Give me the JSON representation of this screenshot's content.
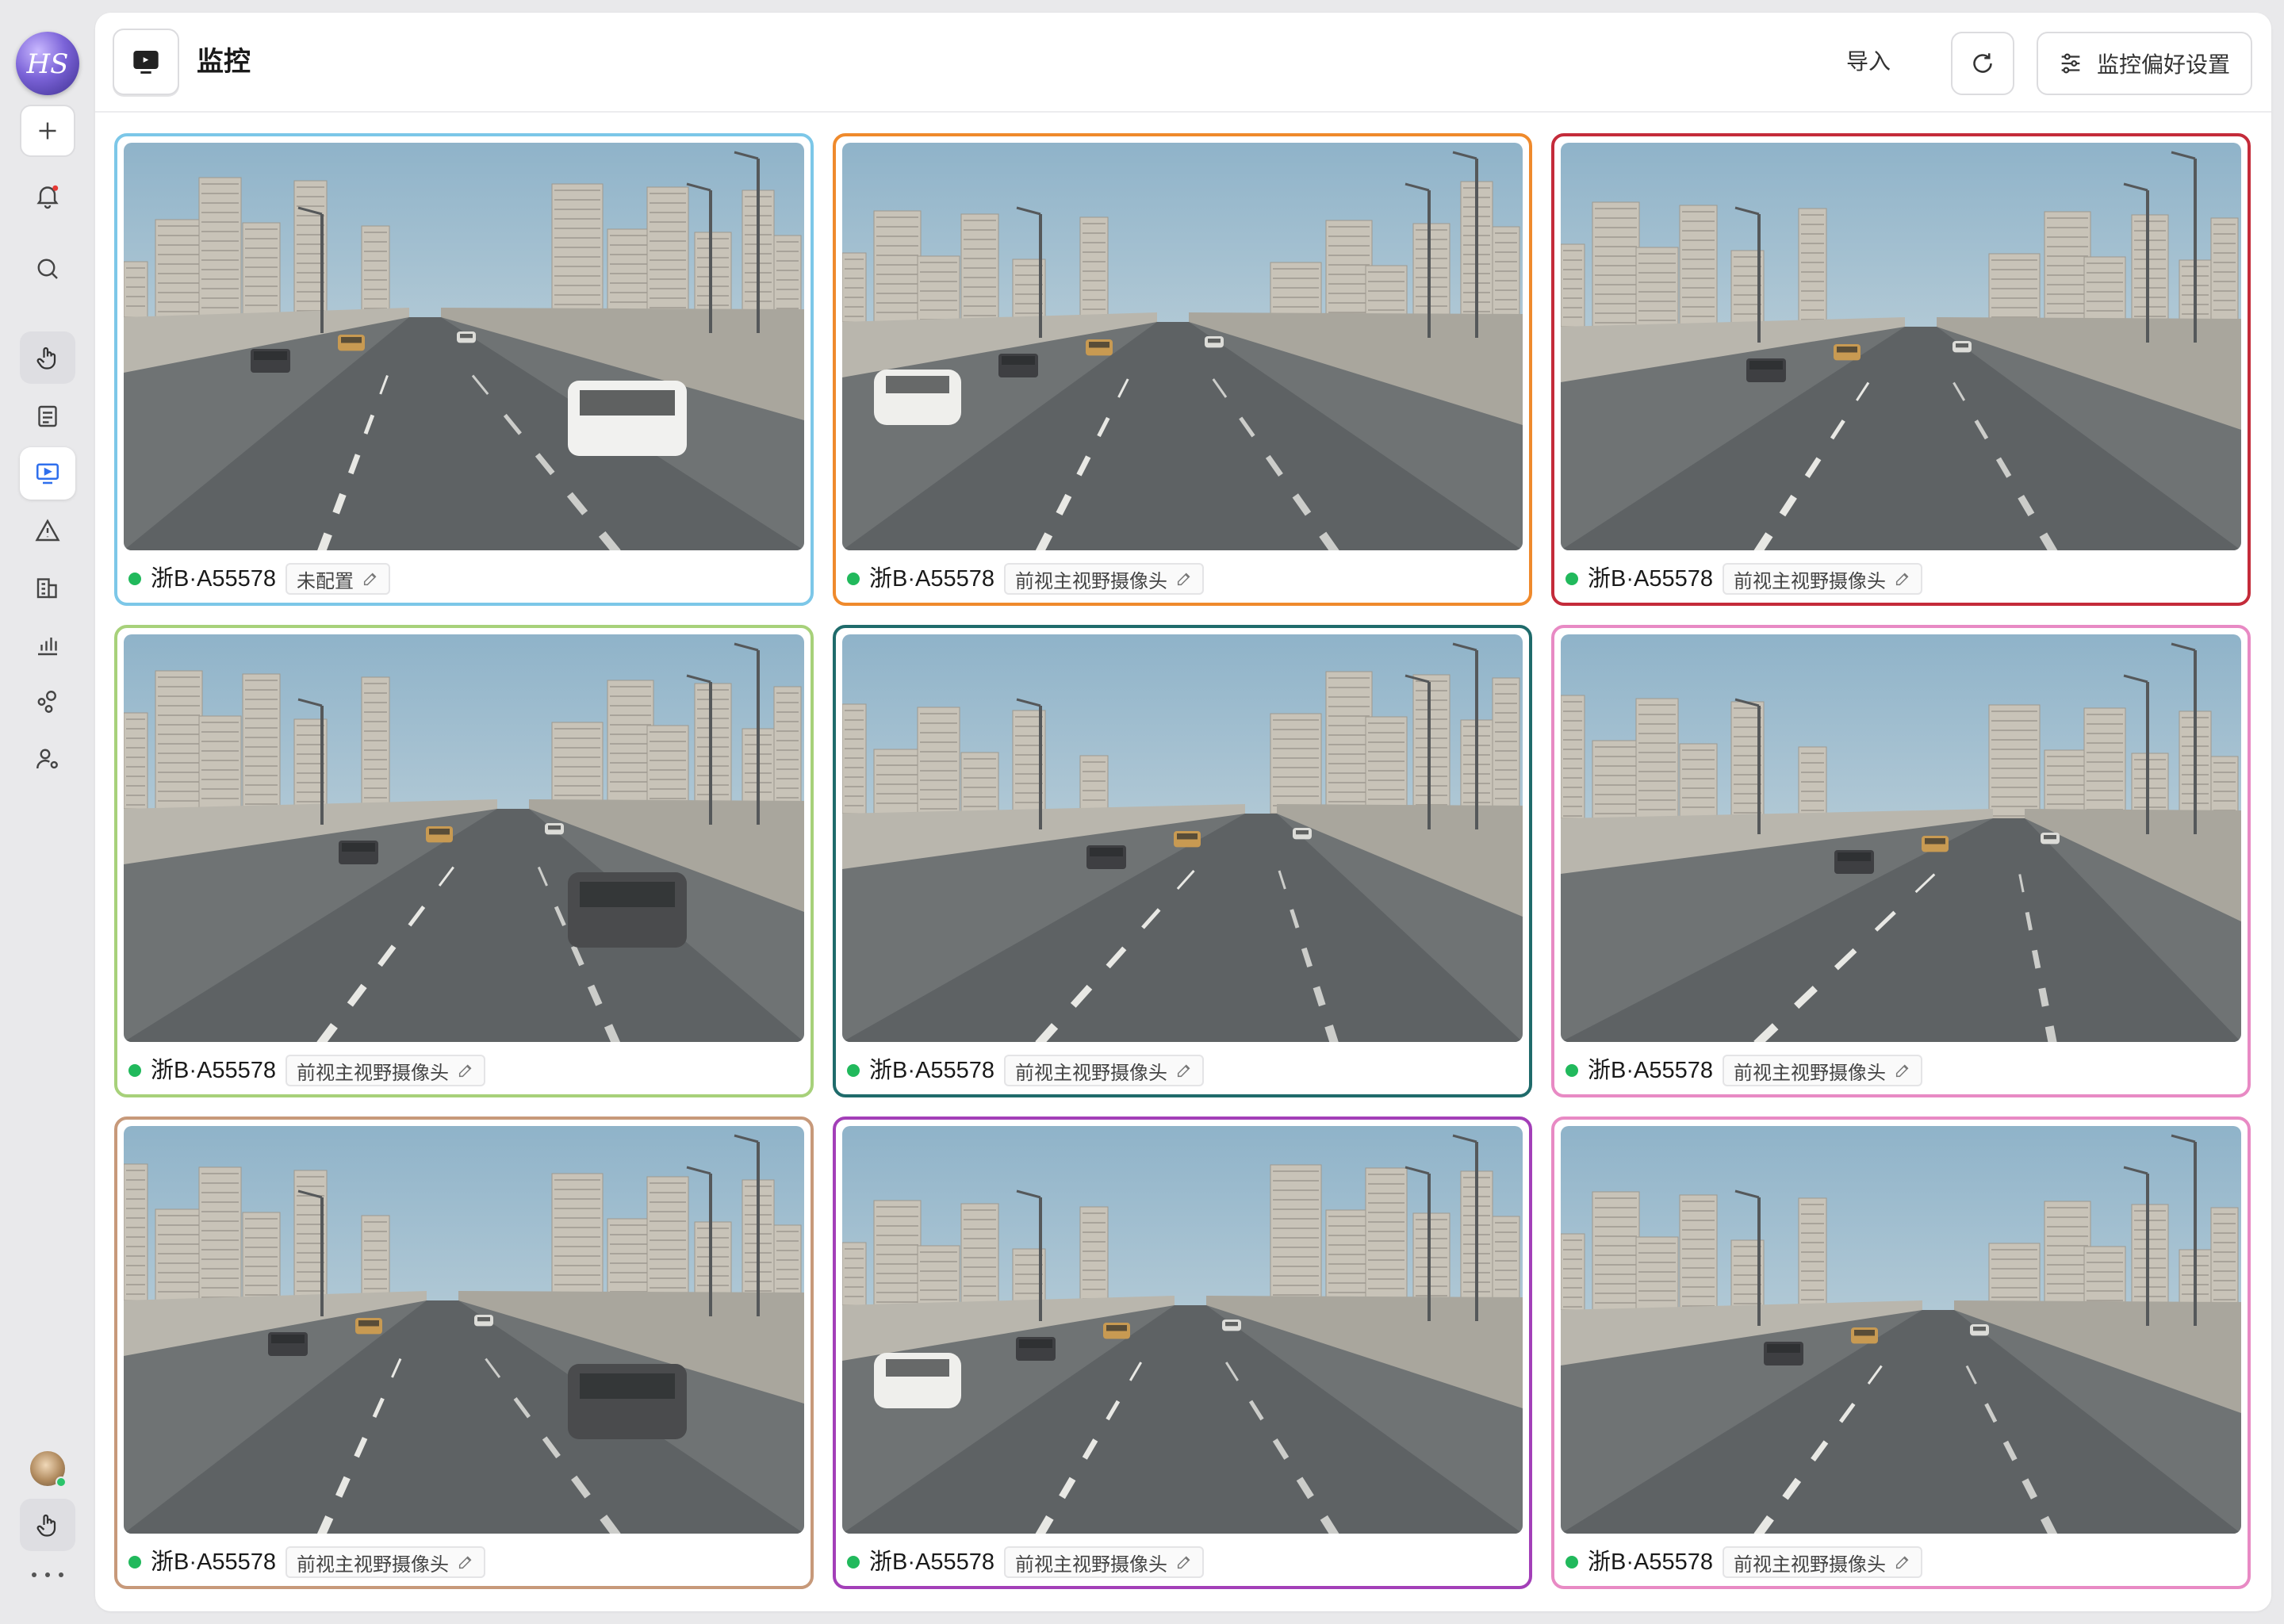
{
  "app": {
    "logo_text": "HS",
    "page_title": "监控",
    "header": {
      "import_label": "导入",
      "preferences_label": "监控偏好设置"
    }
  },
  "sidebar": {
    "items": [
      {
        "name": "add-icon"
      },
      {
        "name": "notification-bell-icon",
        "badge": true
      },
      {
        "name": "search-icon"
      },
      {
        "name": "hand-pointer-icon"
      },
      {
        "name": "document-icon"
      },
      {
        "name": "monitor-icon",
        "active": true
      },
      {
        "name": "warning-icon"
      },
      {
        "name": "building-icon"
      },
      {
        "name": "bar-chart-icon"
      },
      {
        "name": "nodes-icon"
      },
      {
        "name": "user-settings-icon"
      }
    ],
    "bottom": [
      "avatar",
      "hand-pointer-icon",
      "more-icon"
    ]
  },
  "cameras": [
    {
      "plate": "浙B·A55578",
      "tag": "未配置",
      "border": "#7cc7e8",
      "scene": "overpass-suv"
    },
    {
      "plate": "浙B·A55578",
      "tag": "前视主视野摄像头",
      "border": "#ef8a2c",
      "scene": "road-signs"
    },
    {
      "plate": "浙B·A55578",
      "tag": "前视主视野摄像头",
      "border": "#c42b3a",
      "scene": "highway-right-wall"
    },
    {
      "plate": "浙B·A55578",
      "tag": "前视主视野摄像头",
      "border": "#a7d17a",
      "scene": "sound-barrier"
    },
    {
      "plate": "浙B·A55578",
      "tag": "前视主视野摄像头",
      "border": "#1f6b6b",
      "scene": "open-highway"
    },
    {
      "plate": "浙B·A55578",
      "tag": "前视主视野摄像头",
      "border": "#e88ac4",
      "scene": "crosshatch"
    },
    {
      "plate": "浙B·A55578",
      "tag": "前视主视野摄像头",
      "border": "#c7997a",
      "scene": "speed-sign"
    },
    {
      "plate": "浙B·A55578",
      "tag": "前视主视野摄像头",
      "border": "#a33fb8",
      "scene": "white-car-left"
    },
    {
      "plate": "浙B·A55578",
      "tag": "前视主视野摄像头",
      "border": "#e88ac4",
      "scene": "crosshatch-2"
    }
  ],
  "colors": {
    "status_online": "#21b95c",
    "accent": "#2f6fed"
  }
}
